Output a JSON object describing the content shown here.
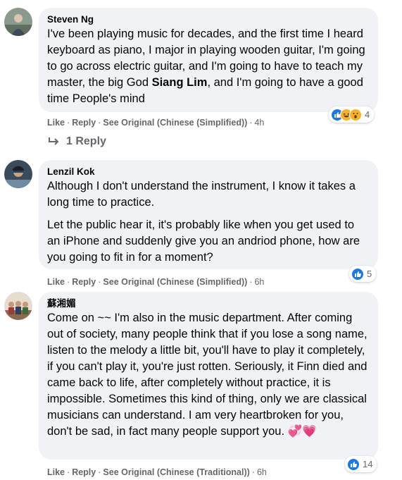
{
  "comments": [
    {
      "author": "Steven Ng",
      "text_pre": "I've been playing music for decades, and the first time I heard keyboard as piano, I major in playing wooden guitar, I'm going to go across electric guitar, and I'm going to have to teach my master, the big God ",
      "text_bold": "Siang Lim",
      "text_post": ", and I'm going to have a good time People's mind",
      "reactions": [
        "like",
        "haha",
        "wow"
      ],
      "reaction_count": "4",
      "like_label": "Like",
      "reply_label": "Reply",
      "see_original_label": "See Original (Chinese (Simplified))",
      "time": "4h"
    },
    {
      "author": "Lenzil Kok",
      "text": "Although I don't understand the instrument, I know it takes a long time to practice.",
      "text2": "Let the public hear it, it's probably like when you get used to an iPhone and suddenly give you an andriod phone, how are you going to fit in for a moment?",
      "reactions": [
        "like"
      ],
      "reaction_count": "5",
      "like_label": "Like",
      "reply_label": "Reply",
      "see_original_label": "See Original (Chinese (Simplified))",
      "time": "6h"
    },
    {
      "author": "蘇湘媚",
      "text": "Come on ~~ I'm also in the music department. After coming out of society, many people think that if you lose a song name, listen to the melody a little bit, you'll have to play it completely, if you can't play it, you're just rotten. Seriously, it Finn died and came back to life, after completely without practice, it is impossible. Sometimes this kind of thing, only we are classical musicians can understand. I am very heartbroken for you, don't be sad, in fact many people support you.",
      "emoji": "💞💗",
      "reactions": [
        "like"
      ],
      "reaction_count": "14",
      "like_label": "Like",
      "reply_label": "Reply",
      "see_original_label": "See Original (Chinese (Traditional))",
      "time": "6h"
    }
  ],
  "replies_link": {
    "label": "1 Reply",
    "icon": "reply-arrow-icon"
  },
  "colors": {
    "bubble": "#f0f2f5",
    "like_blue": "#1877f2",
    "reaction_yellow": "#f7b125",
    "meta_gray": "#65676b"
  }
}
